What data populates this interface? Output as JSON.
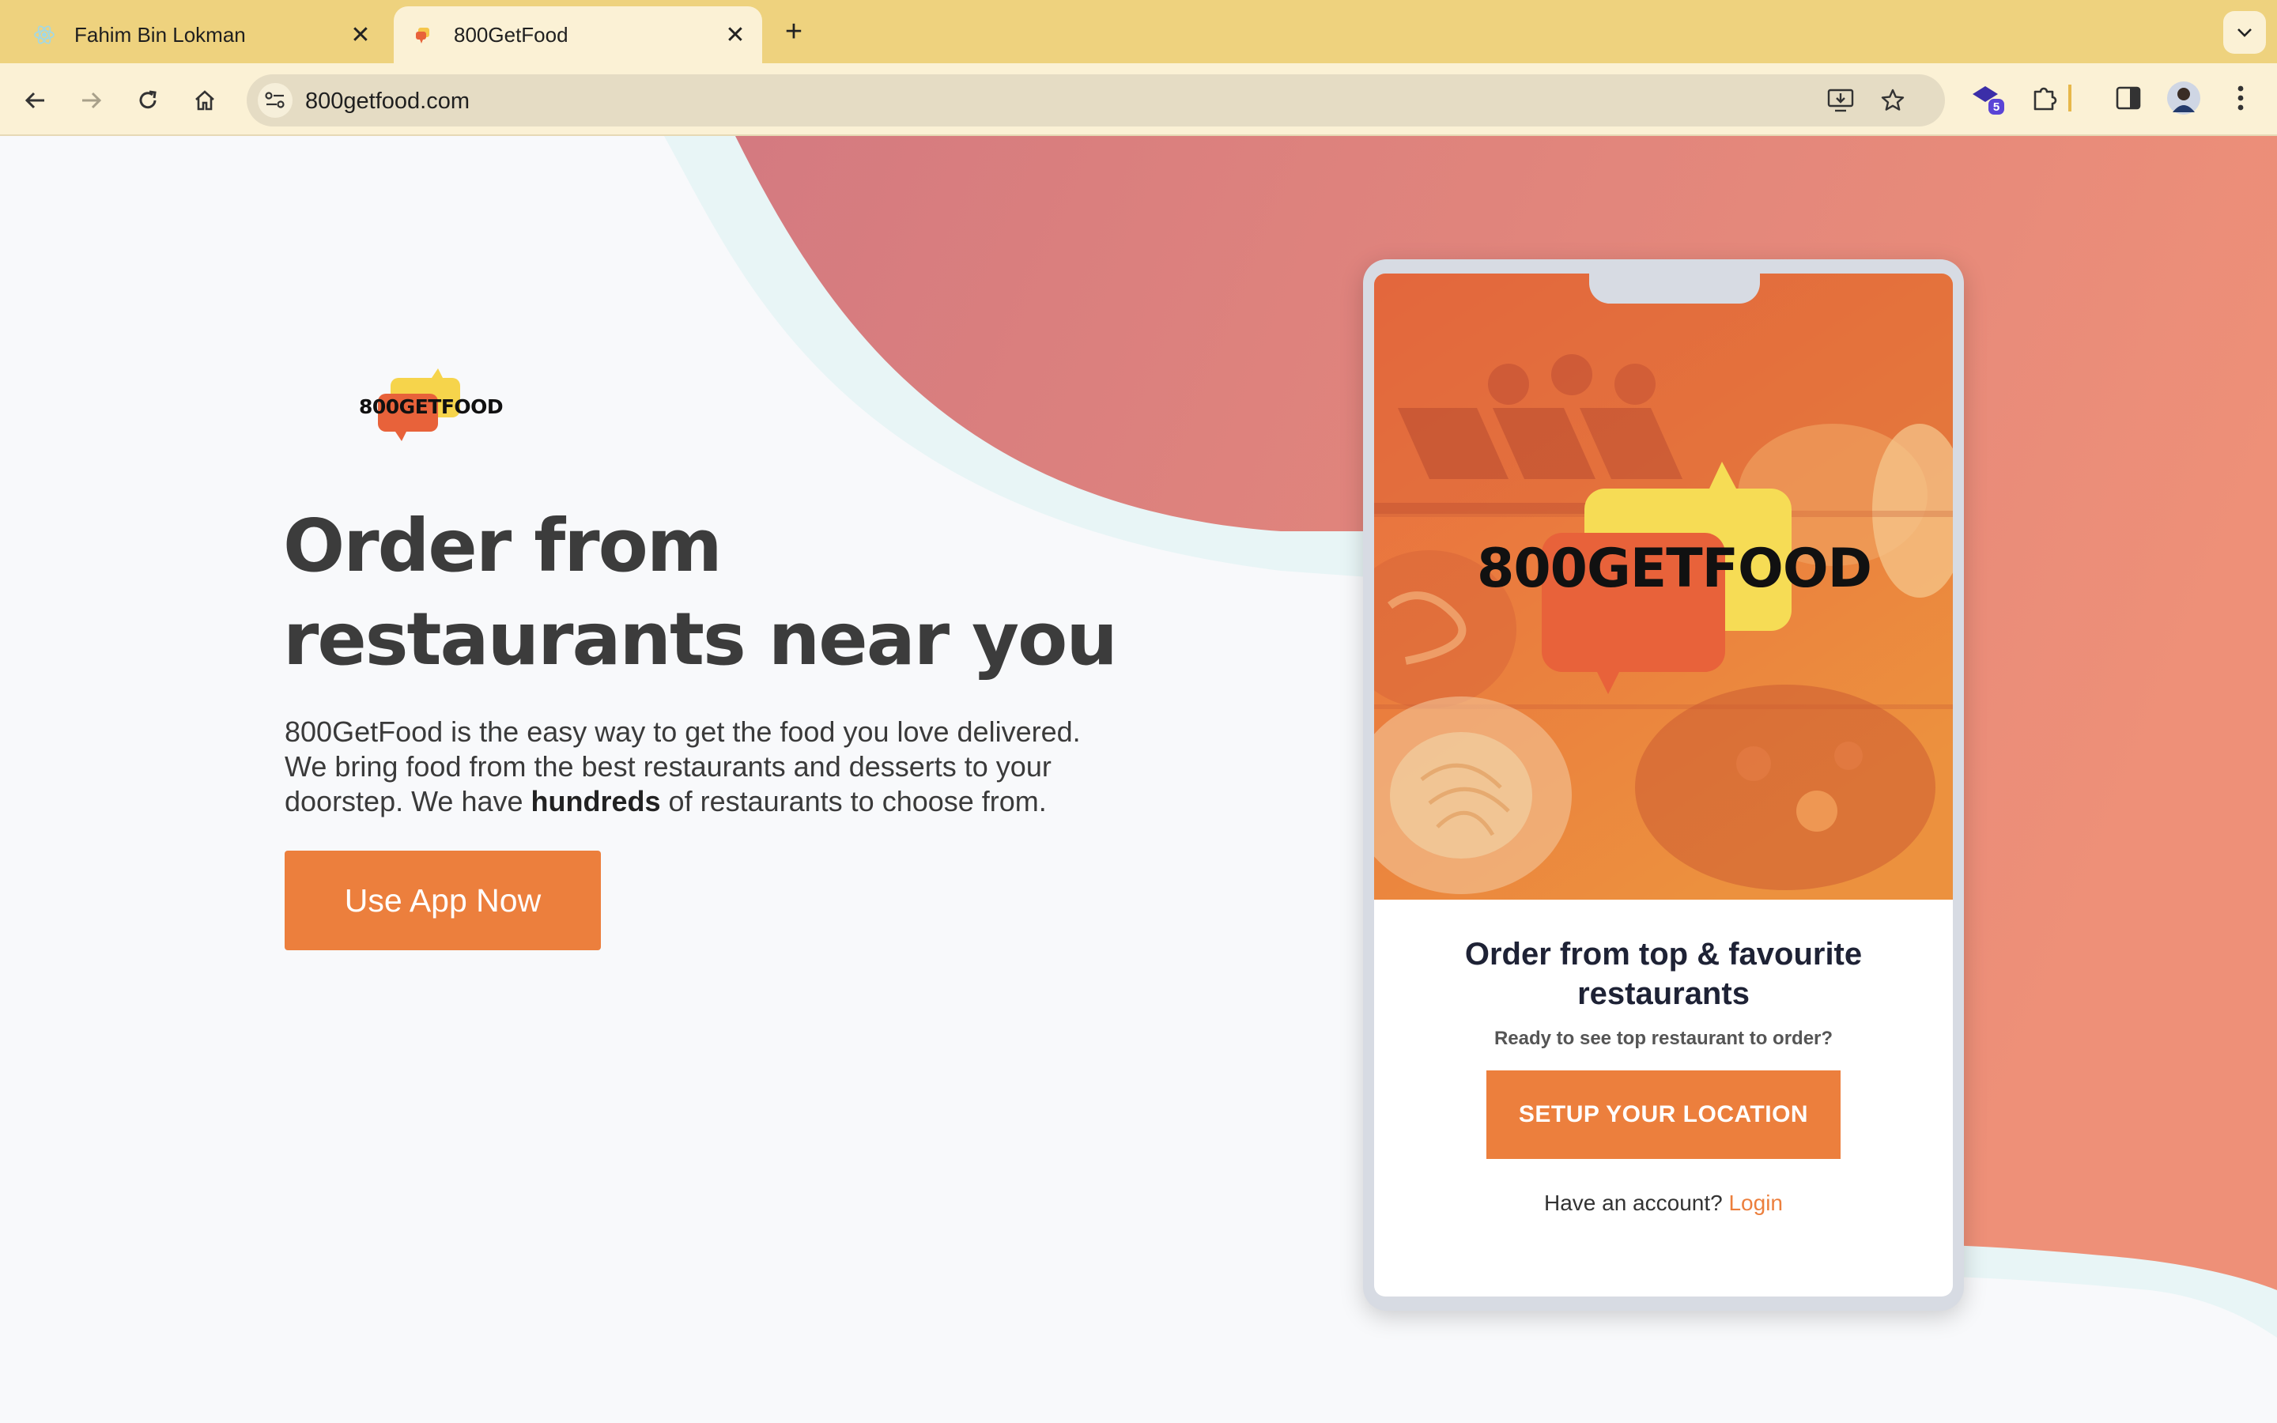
{
  "browser": {
    "tabs": [
      {
        "title": "Fahim Bin Lokman",
        "active": false
      },
      {
        "title": "800GetFood",
        "active": true
      }
    ],
    "url": "800getfood.com",
    "extension_badge": "5"
  },
  "hero": {
    "logo_text": "800GETFOOD",
    "title_line1": "Order from",
    "title_line2": "restaurants near you",
    "description_part1": "800GetFood is the easy way to get the food you love delivered. We bring food from the best restaurants and desserts to your doorstep. We have ",
    "description_bold": "hundreds",
    "description_part2": " of restaurants to choose from.",
    "cta_label": "Use App Now"
  },
  "phone": {
    "logo_text": "800GETFOOD",
    "heading": "Order from top & favourite restaurants",
    "subtext": "Ready to see top restaurant to order?",
    "button_label": "SETUP YOUR LOCATION",
    "login_prompt": "Have an account?",
    "login_link": "Login"
  },
  "colors": {
    "accent": "#ec7f3d",
    "tabbar": "#eed27e",
    "toolbar": "#fbf1d5",
    "wave_start": "#d47a80",
    "wave_end": "#ee9078"
  }
}
